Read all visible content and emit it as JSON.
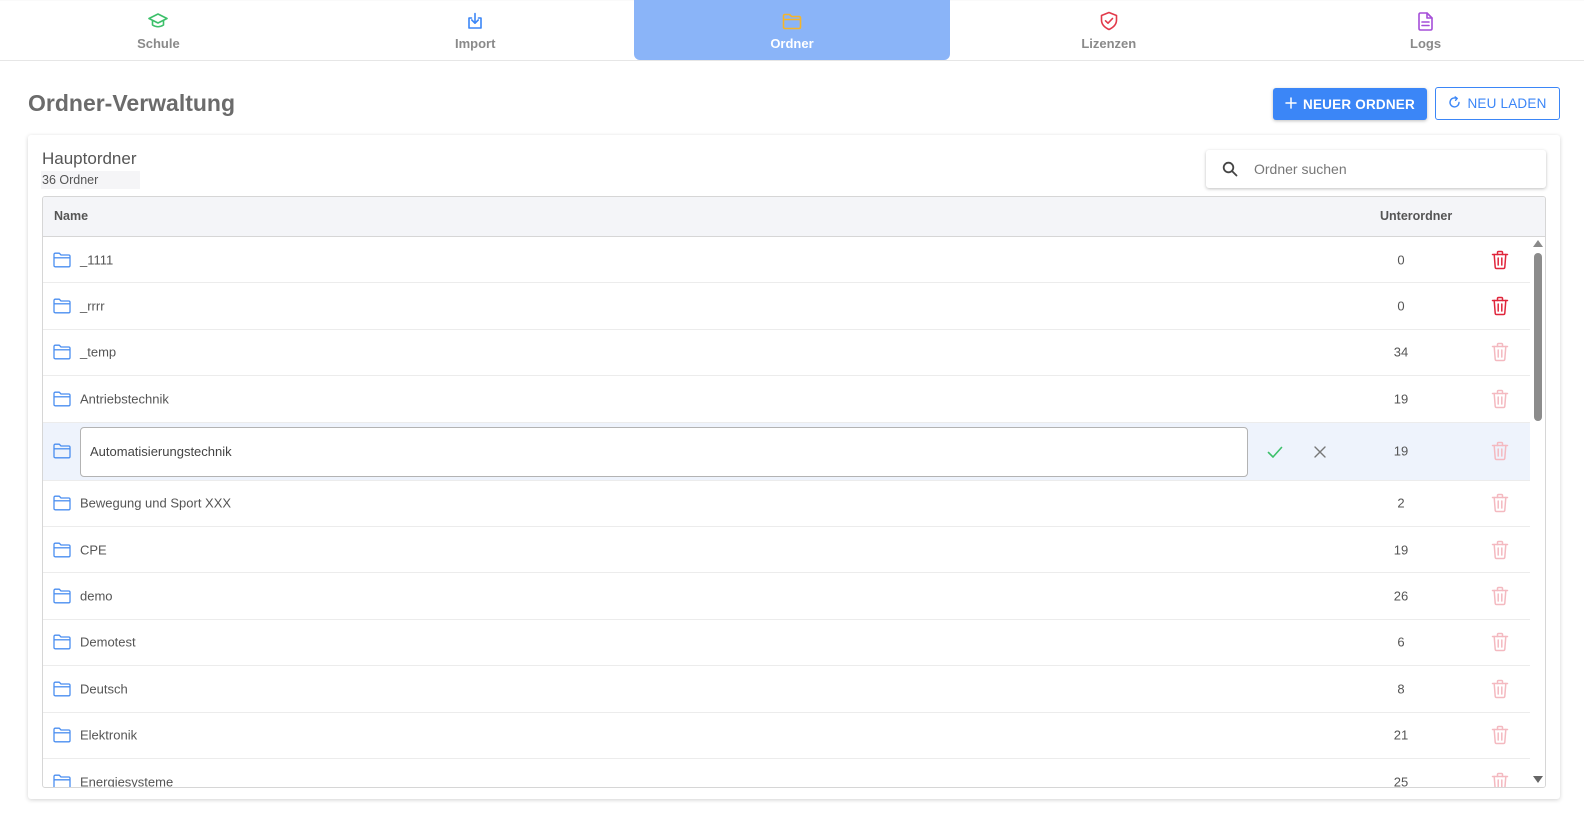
{
  "nav": {
    "items": [
      {
        "label": "Schule",
        "icon": "graduation-cap-icon",
        "color": "#3cc06a",
        "active": false
      },
      {
        "label": "Import",
        "icon": "download-icon",
        "color": "#3b86f7",
        "active": false
      },
      {
        "label": "Ordner",
        "icon": "folder-icon",
        "color": "#f5b52a",
        "active": true
      },
      {
        "label": "Lizenzen",
        "icon": "shield-check-icon",
        "color": "#e23a4b",
        "active": false
      },
      {
        "label": "Logs",
        "icon": "document-icon",
        "color": "#a54ed8",
        "active": false
      }
    ]
  },
  "header": {
    "title": "Ordner-Verwaltung",
    "new_folder_label": "NEUER ORDNER",
    "reload_label": "NEU LADEN"
  },
  "card": {
    "title": "Hauptordner",
    "count": "36 Ordner",
    "search_placeholder": "Ordner suchen"
  },
  "table": {
    "columns": {
      "name": "Name",
      "subfolders": "Unterordner"
    },
    "rows": [
      {
        "name": "_1111",
        "count": "0",
        "deletable": true,
        "editing": false
      },
      {
        "name": "_rrrr",
        "count": "0",
        "deletable": true,
        "editing": false
      },
      {
        "name": "_temp",
        "count": "34",
        "deletable": false,
        "editing": false
      },
      {
        "name": "Antriebstechnik",
        "count": "19",
        "deletable": false,
        "editing": false
      },
      {
        "name": "Automatisierungstechnik",
        "count": "19",
        "deletable": false,
        "editing": true
      },
      {
        "name": "Bewegung und Sport XXX",
        "count": "2",
        "deletable": false,
        "editing": false
      },
      {
        "name": "CPE",
        "count": "19",
        "deletable": false,
        "editing": false
      },
      {
        "name": "demo",
        "count": "26",
        "deletable": false,
        "editing": false
      },
      {
        "name": "Demotest",
        "count": "6",
        "deletable": false,
        "editing": false
      },
      {
        "name": "Deutsch",
        "count": "8",
        "deletable": false,
        "editing": false
      },
      {
        "name": "Elektronik",
        "count": "21",
        "deletable": false,
        "editing": false
      },
      {
        "name": "Energiesysteme",
        "count": "25",
        "deletable": false,
        "editing": false
      }
    ]
  },
  "colors": {
    "accent": "#3b86f7",
    "nav_active_bg": "#8ab4f8",
    "folder_icon": "#4a8ef0",
    "delete_active": "#e0253b",
    "delete_disabled": "#f4b9c0",
    "confirm": "#3cc06a",
    "cancel": "#777777"
  }
}
